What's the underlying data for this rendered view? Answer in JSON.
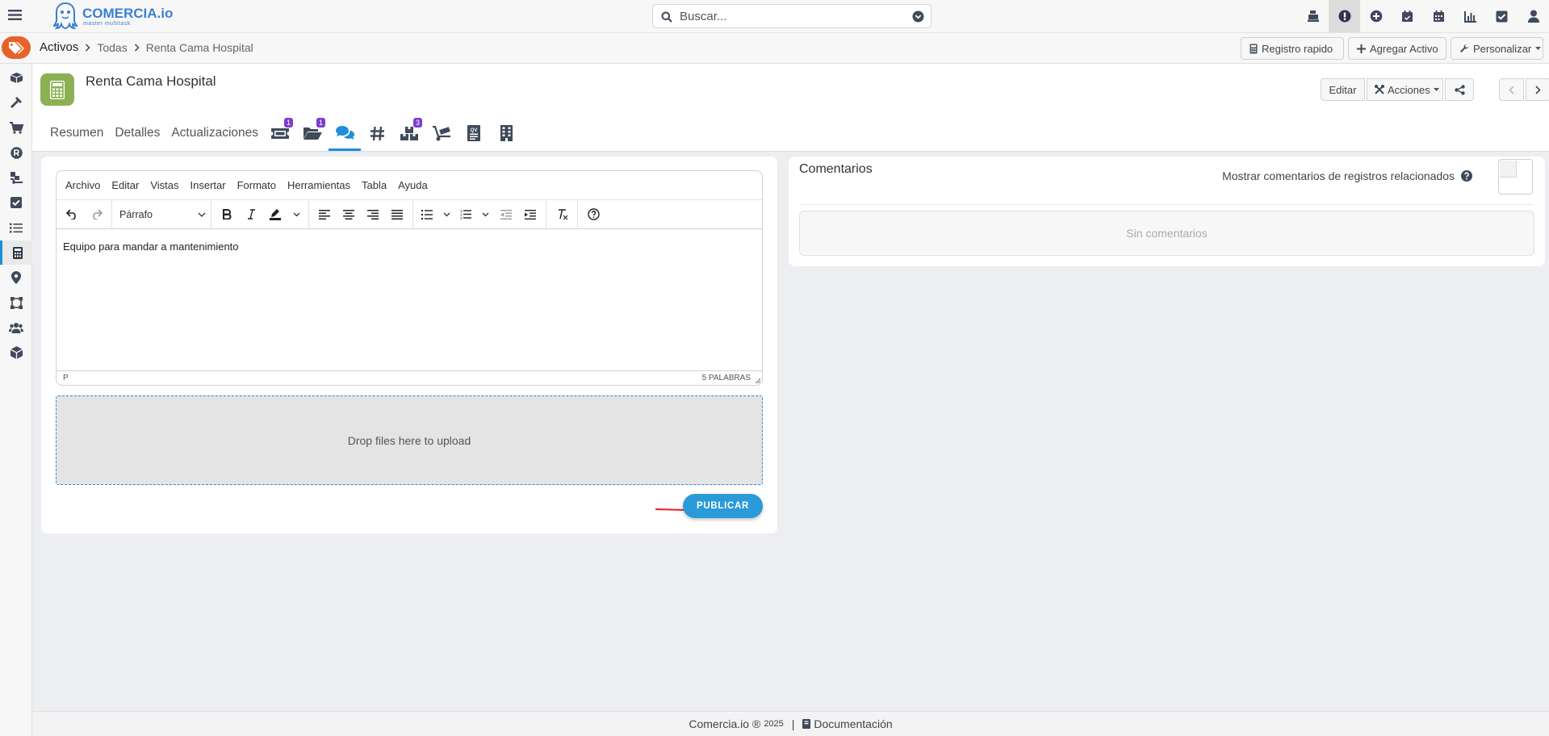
{
  "brand": {
    "name": "COMERCIA.io",
    "tagline": "master multitask"
  },
  "search": {
    "placeholder": "Buscar..."
  },
  "top_icons": [
    "cash-register-icon",
    "exclamation-circle-icon",
    "plus-circle-icon",
    "calendar-check-icon",
    "calendar-icon",
    "bar-chart-icon",
    "check-square-icon",
    "user-icon"
  ],
  "breadcrumb": {
    "items": [
      "Activos",
      "Todas",
      "Renta Cama Hospital"
    ]
  },
  "top_actions": {
    "quick": "Registro rapido",
    "add": "Agregar Activo",
    "customize": "Personalizar"
  },
  "sidebar": [
    "box-icon",
    "hammer-icon",
    "cart-icon",
    "registered-icon",
    "dolly-icon",
    "check-square-icon",
    "list-icon",
    "calculator-icon",
    "location-pin-icon",
    "vector-square-icon",
    "users-icon",
    "cube-icon"
  ],
  "record": {
    "title": "Renta Cama Hospital",
    "edit": "Editar",
    "actions": "Acciones"
  },
  "tabs": {
    "text": [
      "Resumen",
      "Detalles",
      "Actualizaciones"
    ],
    "badges": {
      "ticket": "1",
      "folder": "1",
      "boxes": "3"
    }
  },
  "editor": {
    "menu": [
      "Archivo",
      "Editar",
      "Vistas",
      "Insertar",
      "Formato",
      "Herramientas",
      "Tabla",
      "Ayuda"
    ],
    "format": "Párrafo",
    "content": "Equipo para mandar a mantenimiento",
    "path": "P",
    "wordcount": "5 PALABRAS"
  },
  "dropzone": "Drop files here to upload",
  "publish": "PUBLICAR",
  "comments": {
    "title": "Comentarios",
    "related": "Mostrar comentarios de registros relacionados",
    "empty": "Sin comentarios"
  },
  "footer": {
    "brand": "Comercia.io ®",
    "year": "2025",
    "sep": "|",
    "docs": "Documentación"
  },
  "colors": {
    "accent": "#2a9ad9",
    "tag": "#e9612a",
    "asset": "#8cb155",
    "badge": "#7d3ccf",
    "annotation_arrow": "#e52020"
  }
}
